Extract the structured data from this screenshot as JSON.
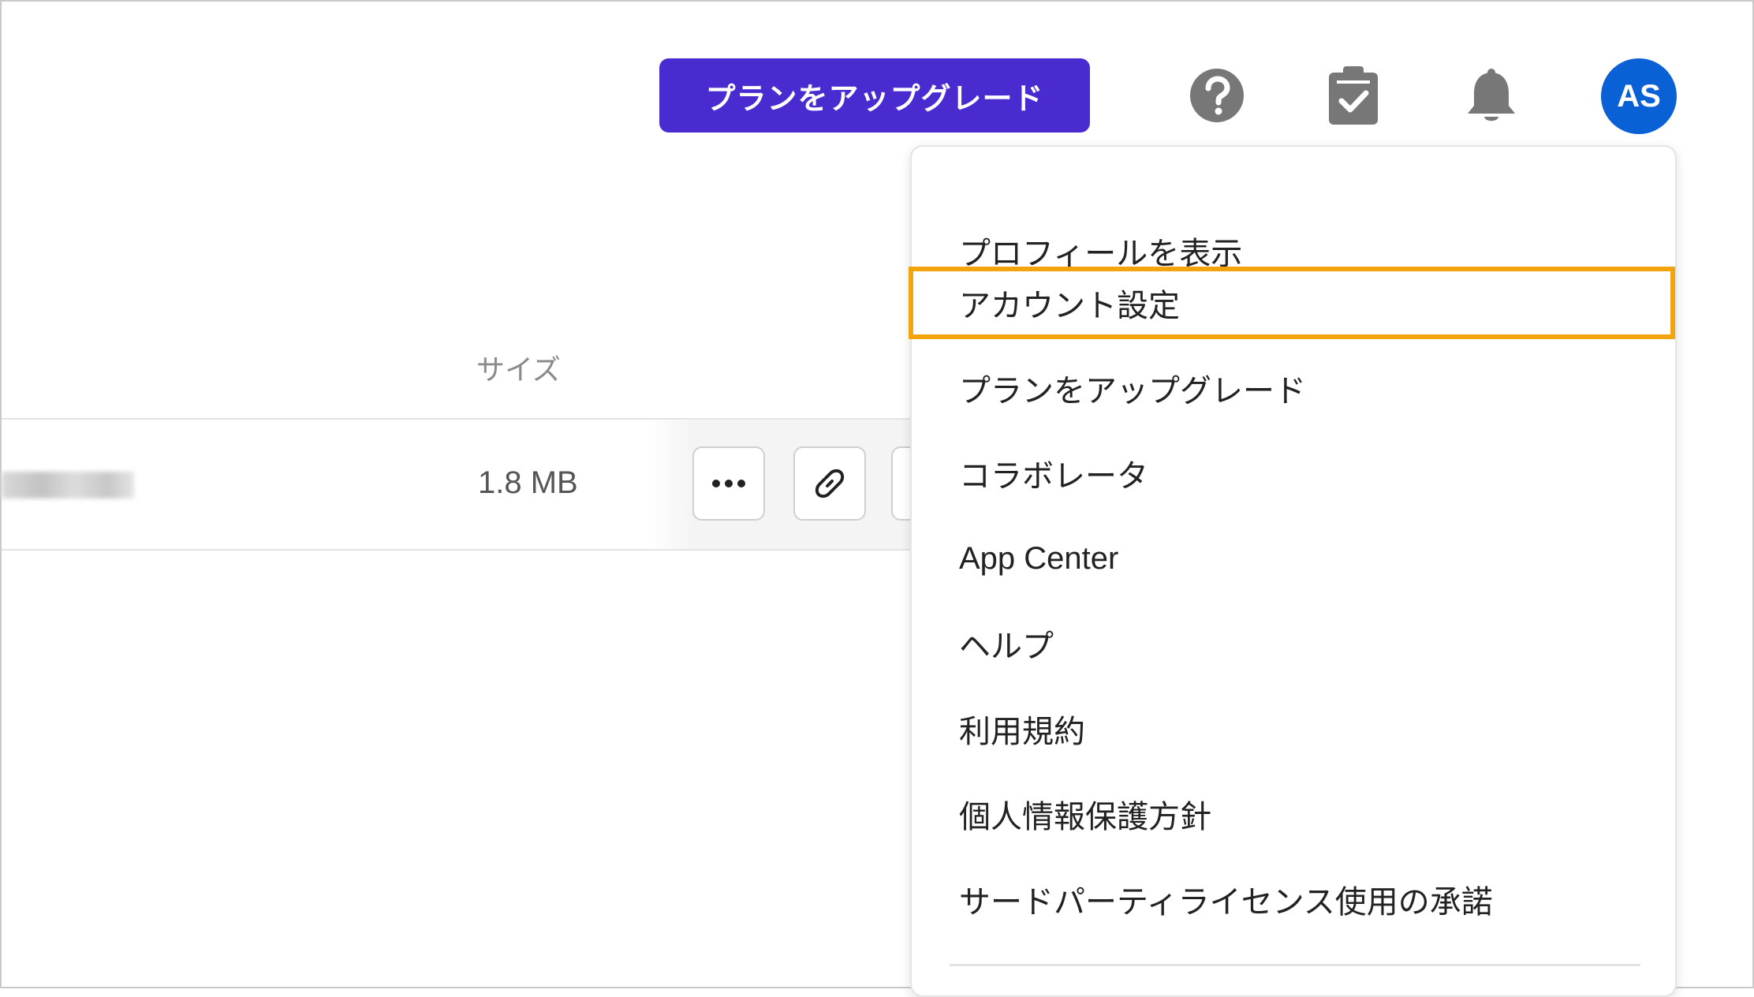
{
  "header": {
    "upgrade_button": "プランをアップグレード",
    "avatar_initials": "AS"
  },
  "table": {
    "size_header": "サイズ",
    "row": {
      "size": "1.8 MB"
    }
  },
  "dropdown": {
    "items": [
      "プロフィールを表示",
      "アカウント設定",
      "プランをアップグレード",
      "コラボレータ",
      "App Center",
      "ヘルプ",
      "利用規約",
      "個人情報保護方針",
      "サードパーティライセンス使用の承諾"
    ],
    "highlighted_index": 1
  },
  "colors": {
    "upgrade_button": "#4a2bd0",
    "avatar": "#0a61d6",
    "highlight_border": "#f2a40f",
    "icon_gray": "#777777"
  }
}
